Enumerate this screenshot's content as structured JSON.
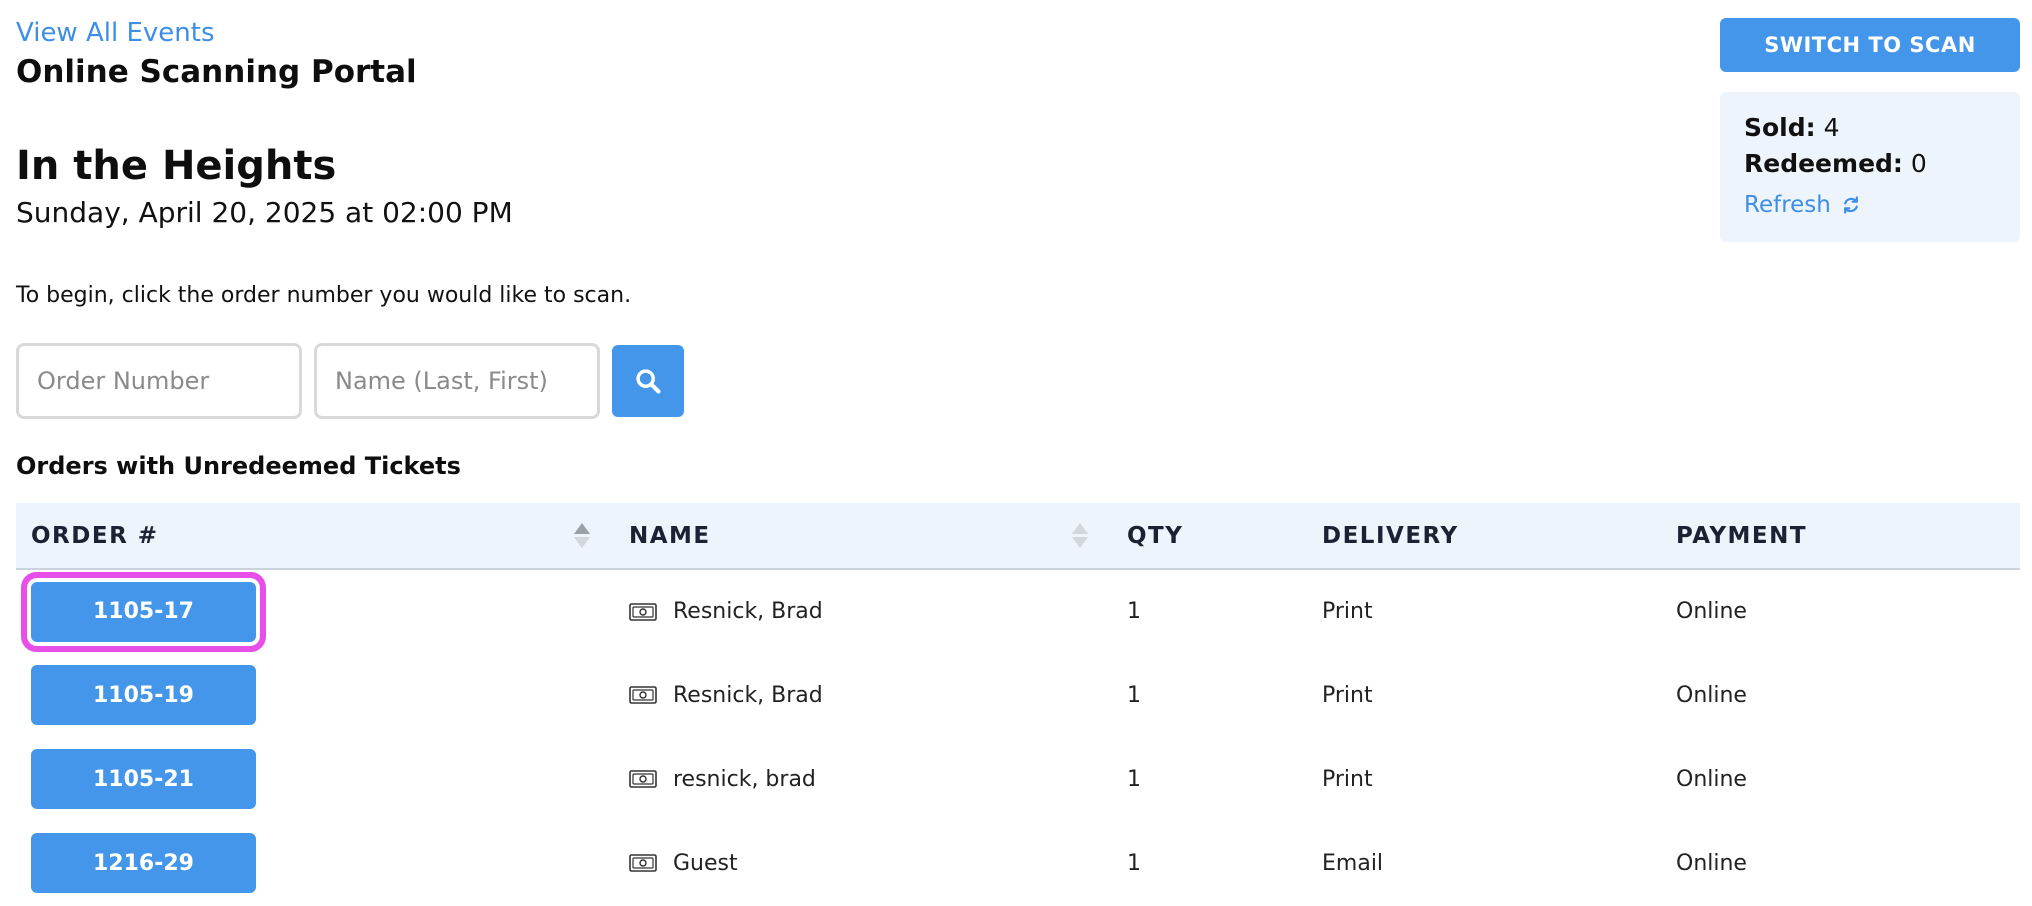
{
  "header": {
    "view_all_link": "View All Events",
    "portal_title": "Online Scanning Portal"
  },
  "event": {
    "title": "In the Heights",
    "date": "Sunday, April 20, 2025 at 02:00 PM"
  },
  "instructions": "To begin, click the order number you would like to scan.",
  "search": {
    "order_placeholder": "Order Number",
    "name_placeholder": "Name (Last, First)",
    "button_icon": "search-icon"
  },
  "panel": {
    "switch_button": "SWITCH TO SCAN",
    "sold_label": "Sold:",
    "sold_value": "4",
    "redeemed_label": "Redeemed:",
    "redeemed_value": "0",
    "refresh_label": "Refresh",
    "refresh_icon": "refresh-icon"
  },
  "section_title": "Orders with Unredeemed Tickets",
  "table": {
    "columns": [
      "ORDER #",
      "NAME",
      "QTY",
      "DELIVERY",
      "PAYMENT"
    ],
    "rows": [
      {
        "order": "1105-17",
        "name": "Resnick, Brad",
        "qty": "1",
        "delivery": "Print",
        "payment": "Online"
      },
      {
        "order": "1105-19",
        "name": "Resnick, Brad",
        "qty": "1",
        "delivery": "Print",
        "payment": "Online"
      },
      {
        "order": "1105-21",
        "name": "resnick, brad",
        "qty": "1",
        "delivery": "Print",
        "payment": "Online"
      },
      {
        "order": "1216-29",
        "name": "Guest",
        "qty": "1",
        "delivery": "Email",
        "payment": "Online"
      }
    ]
  },
  "colors": {
    "accent": "#4496ea",
    "panel_bg": "#eef4fb",
    "highlight": "#e64fe8"
  }
}
